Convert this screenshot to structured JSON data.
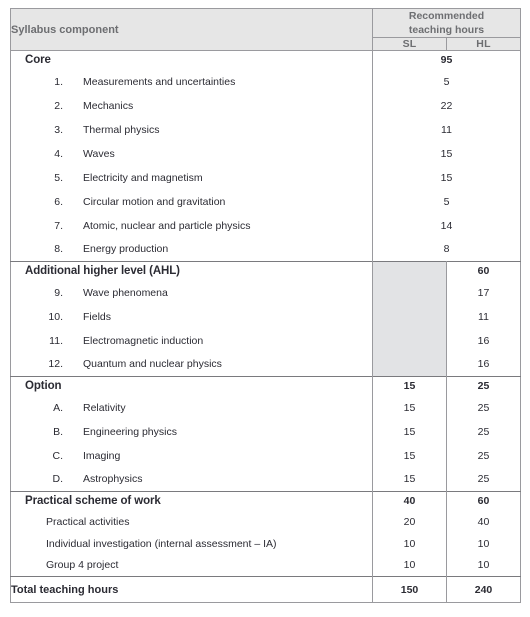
{
  "table": {
    "headers": {
      "component": "Syllabus component",
      "recommended_line1": "Recommended",
      "recommended_line2": "teaching hours",
      "sl": "SL",
      "hl": "HL"
    },
    "sections": [
      {
        "title": "Core",
        "merged_hours": true,
        "sl": "95",
        "hl": "",
        "items": [
          {
            "no": "1.",
            "label": "Measurements and uncertainties",
            "sl": "5",
            "hl": ""
          },
          {
            "no": "2.",
            "label": "Mechanics",
            "sl": "22",
            "hl": ""
          },
          {
            "no": "3.",
            "label": "Thermal physics",
            "sl": "11",
            "hl": ""
          },
          {
            "no": "4.",
            "label": "Waves",
            "sl": "15",
            "hl": ""
          },
          {
            "no": "5.",
            "label": "Electricity and magnetism",
            "sl": "15",
            "hl": ""
          },
          {
            "no": "6.",
            "label": "Circular motion and gravitation",
            "sl": "5",
            "hl": ""
          },
          {
            "no": "7.",
            "label": "Atomic, nuclear and particle physics",
            "sl": "14",
            "hl": ""
          },
          {
            "no": "8.",
            "label": "Energy production",
            "sl": "8",
            "hl": ""
          }
        ]
      },
      {
        "title": "Additional higher level (AHL)",
        "merged_hours": false,
        "sl_shaded": true,
        "sl": "",
        "hl": "60",
        "items": [
          {
            "no": "9.",
            "label": "Wave phenomena",
            "sl": "",
            "hl": "17"
          },
          {
            "no": "10.",
            "label": "Fields",
            "sl": "",
            "hl": "11"
          },
          {
            "no": "11.",
            "label": "Electromagnetic induction",
            "sl": "",
            "hl": "16"
          },
          {
            "no": "12.",
            "label": "Quantum and nuclear physics",
            "sl": "",
            "hl": "16"
          }
        ]
      },
      {
        "title": "Option",
        "merged_hours": false,
        "sl_shaded": false,
        "sl": "15",
        "hl": "25",
        "items": [
          {
            "no": "A.",
            "label": "Relativity",
            "sl": "15",
            "hl": "25"
          },
          {
            "no": "B.",
            "label": "Engineering physics",
            "sl": "15",
            "hl": "25"
          },
          {
            "no": "C.",
            "label": "Imaging",
            "sl": "15",
            "hl": "25"
          },
          {
            "no": "D.",
            "label": "Astrophysics",
            "sl": "15",
            "hl": "25"
          }
        ]
      },
      {
        "title": "Practical scheme of work",
        "merged_hours": false,
        "sl_shaded": false,
        "sl": "40",
        "hl": "60",
        "items": [
          {
            "no": "",
            "label": "Practical activities",
            "sl": "20",
            "hl": "40"
          },
          {
            "no": "",
            "label": "Individual investigation (internal assessment – IA)",
            "sl": "10",
            "hl": "10"
          },
          {
            "no": "",
            "label": "Group 4 project",
            "sl": "10",
            "hl": "10"
          }
        ]
      }
    ],
    "total": {
      "label": "Total teaching hours",
      "sl": "150",
      "hl": "240"
    }
  },
  "colors": {
    "header_bg": "#e6e6e6",
    "header_text": "#6d6e71",
    "shaded_cell": "#e2e3e5",
    "border": "#9a9a9e",
    "section_rule": "#7a7a7e",
    "body_text": "#2b2b33"
  }
}
